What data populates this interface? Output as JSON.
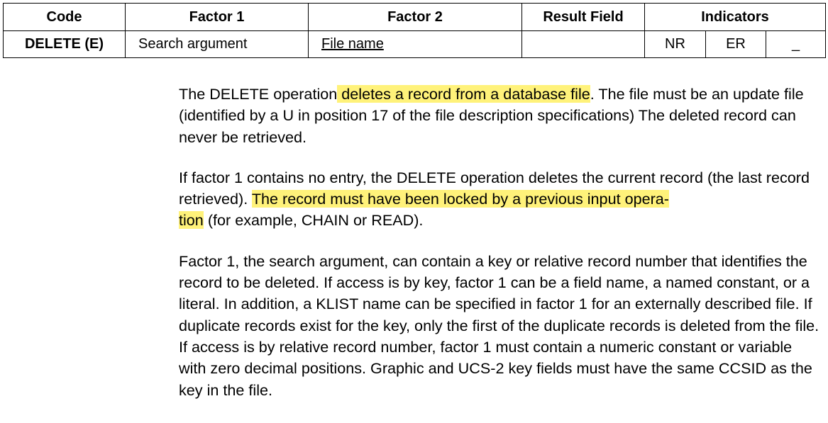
{
  "table": {
    "headers": {
      "code": "Code",
      "factor1": "Factor 1",
      "factor2": "Factor 2",
      "result": "Result Field",
      "indicators": "Indicators"
    },
    "row": {
      "code": "DELETE (E)",
      "factor1": "Search argument",
      "factor2": "File name",
      "result": "",
      "ind1": "NR",
      "ind2": "ER",
      "ind3": "_"
    }
  },
  "paragraphs": {
    "p1": {
      "a": "The DELETE operation",
      "hl": " deletes a record from a database file",
      "b": ". The file must be an update file (identified by a U in position 17 of the file description specifications) The deleted record can never be retrieved."
    },
    "p2": {
      "a": "If factor 1 contains no entry, the DELETE operation deletes the current record (the last record retrieved). ",
      "hl1": "The record must have been locked by a previous input opera-",
      "hl2": "tion",
      "b": " (for example, CHAIN or READ)."
    },
    "p3": "Factor 1, the search argument, can contain a key or relative record number that identifies the record to be deleted. If access is by key, factor 1 can be a field name, a named constant, or a literal. In addition, a KLIST name can be specified in factor 1 for an externally described file. If duplicate records exist for the key, only the first of the duplicate records is deleted from the file. If access is by relative record number, factor 1 must contain a numeric constant or variable with zero decimal positions. Graphic and UCS-2 key fields must have the same CCSID as the key in the file."
  }
}
